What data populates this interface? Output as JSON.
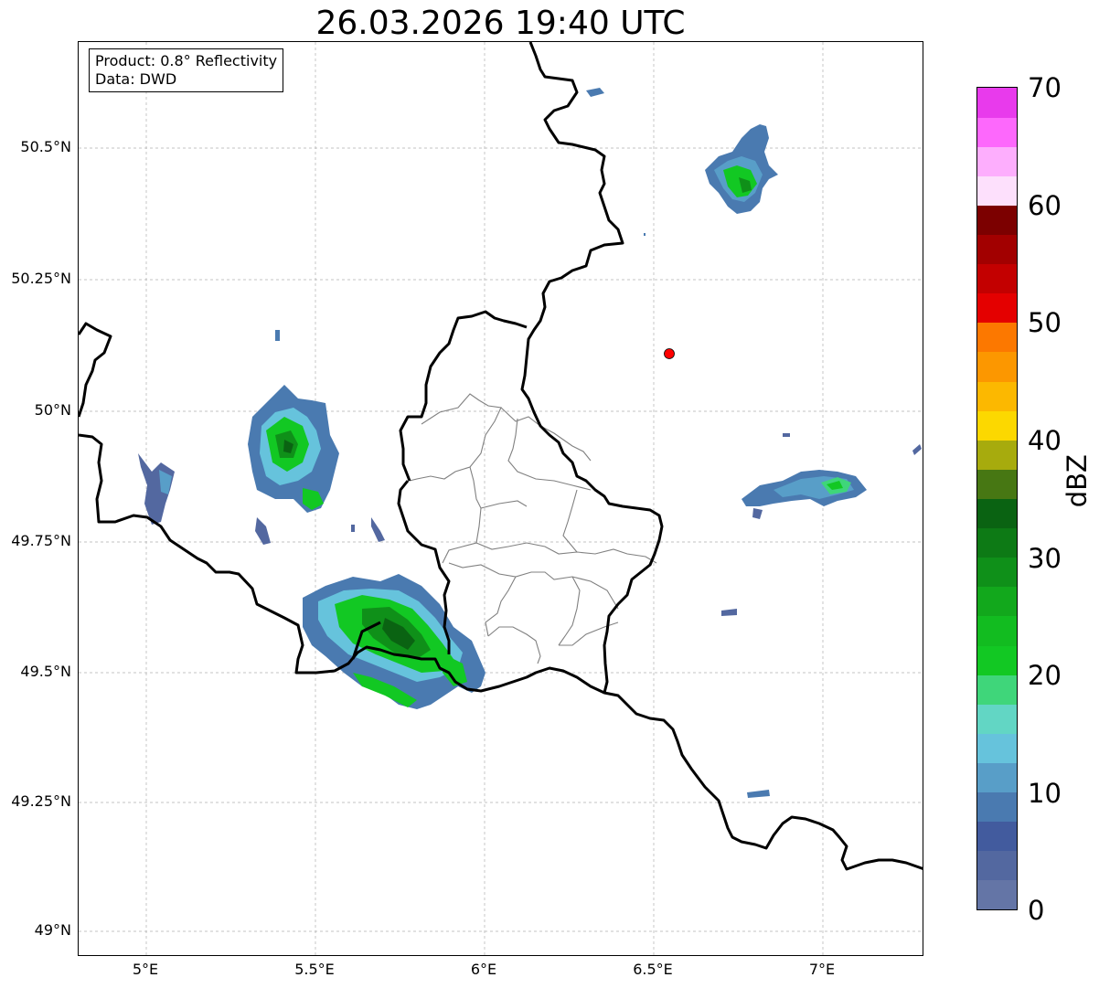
{
  "title": "26.03.2026 19:40 UTC",
  "info": {
    "product": "Product: 0.8° Reflectivity",
    "data_source": "Data: DWD"
  },
  "lat_labels": [
    "50.5°N",
    "50.25°N",
    "50°N",
    "49.75°N",
    "49.5°N",
    "49.25°N",
    "49°N"
  ],
  "lon_labels": [
    "5°E",
    "5.5°E",
    "6°E",
    "6.5°E",
    "7°E"
  ],
  "colorbar": {
    "label": "dBZ",
    "ticks": [
      "0",
      "10",
      "20",
      "30",
      "40",
      "50",
      "60",
      "70"
    ],
    "colors": [
      "#6475a6",
      "#5368a0",
      "#425b9e",
      "#4a7ab0",
      "#589ec8",
      "#66c3dc",
      "#62d6c4",
      "#3fd67a",
      "#12c823",
      "#12bc20",
      "#12a81c",
      "#0f9019",
      "#0d7a15",
      "#0a6312",
      "#477713",
      "#a7ab0d",
      "#fcd800",
      "#fcb800",
      "#fc9700",
      "#fc7800",
      "#e40000",
      "#c30000",
      "#a20000",
      "#7c0000",
      "#fde0fc",
      "#fdaefd",
      "#fd68fc",
      "#e83aec"
    ]
  },
  "map_colors": {
    "border": "#000000",
    "districts": "#808080",
    "grid": "#b0b0b0",
    "radar_site": "#ff0000"
  },
  "map_extent": {
    "lon_min": 4.8,
    "lon_max": 7.3,
    "lat_min": 48.95,
    "lat_max": 50.69
  },
  "radar_site": {
    "lon": 6.548,
    "lat": 50.109
  }
}
